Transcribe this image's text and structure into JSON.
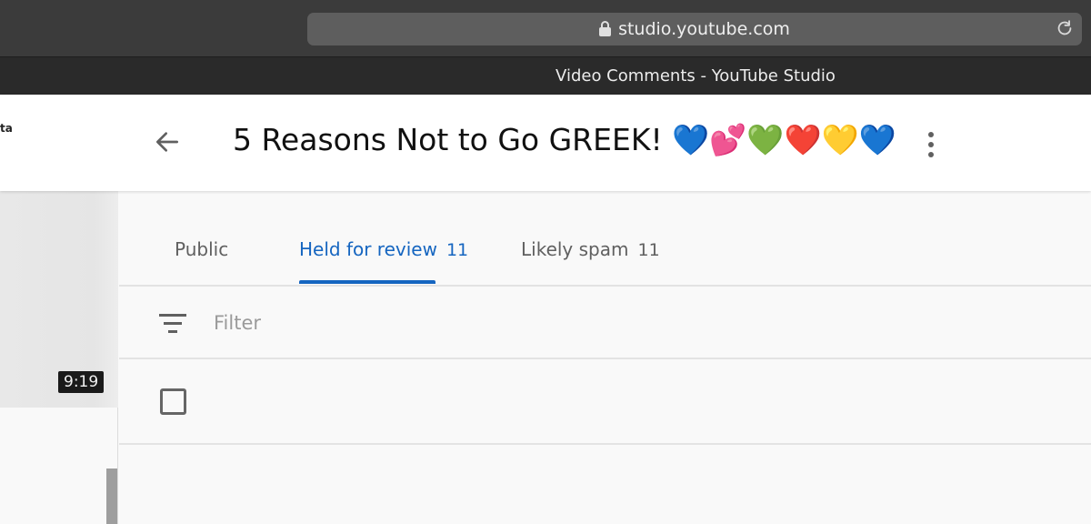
{
  "browser": {
    "url": "studio.youtube.com",
    "tab_title": "Video Comments - YouTube Studio"
  },
  "header": {
    "left_fragment": "ta",
    "video_title": "5 Reasons Not to Go GREEK! 💙💕💚❤️💛💙",
    "back_icon": "arrow-back-icon",
    "more_icon": "more-vert-icon"
  },
  "sidebar": {
    "duration": "9:19"
  },
  "tabs": [
    {
      "label": "Public",
      "count": ""
    },
    {
      "label": "Held for review",
      "count": "11",
      "active": true
    },
    {
      "label": "Likely spam",
      "count": "11"
    }
  ],
  "filter": {
    "placeholder": "Filter",
    "icon": "filter-lines-icon"
  },
  "colors": {
    "accent": "#1565c0",
    "chrome_dark": "#2a2a2a",
    "url_bar": "#5e5e5e"
  }
}
